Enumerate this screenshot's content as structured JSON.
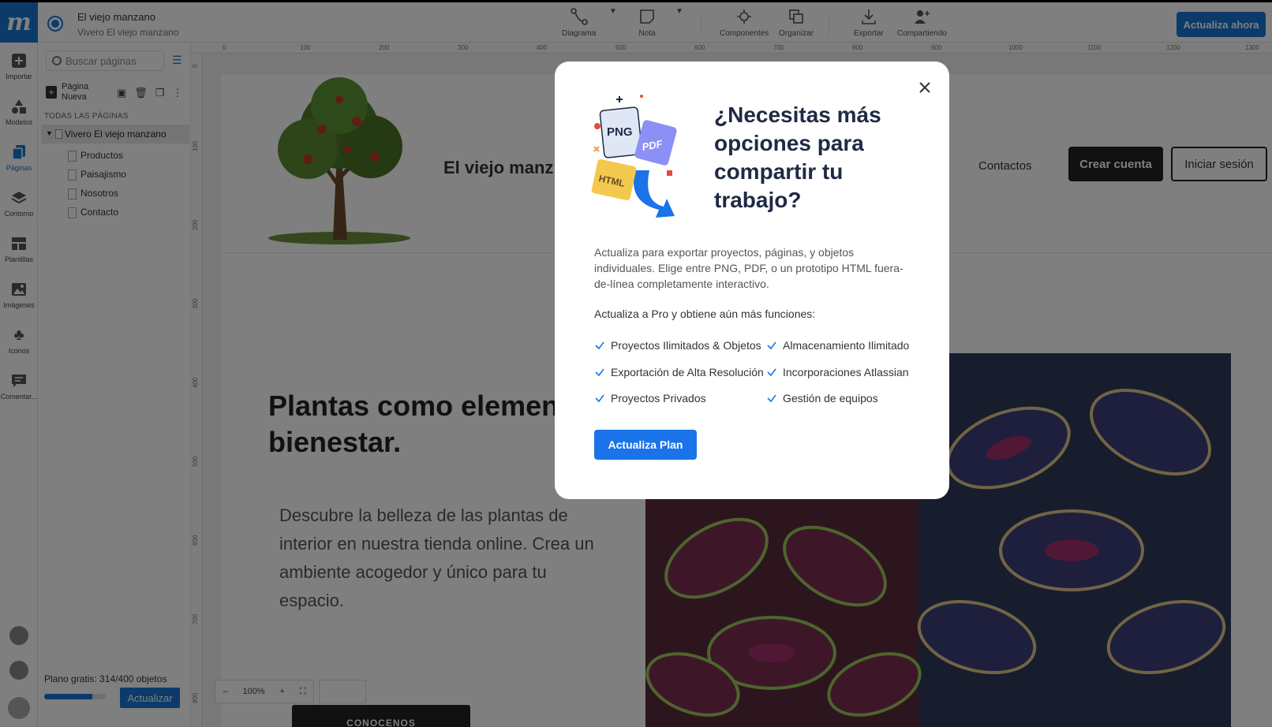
{
  "app": {
    "logo": "m",
    "project_title": "El viejo manzano",
    "project_subtitle": "Vivero El viejo manzano",
    "upgrade_now": "Actualiza ahora"
  },
  "toolbar": [
    {
      "label": "Diagrama",
      "icon": "diagram-icon"
    },
    {
      "label": "Nota",
      "icon": "note-icon"
    },
    {
      "label": "Componentes",
      "icon": "components-icon"
    },
    {
      "label": "Organizar",
      "icon": "arrange-icon"
    },
    {
      "label": "Exportar",
      "icon": "export-icon"
    },
    {
      "label": "Compartiendo",
      "icon": "share-icon"
    }
  ],
  "rail": [
    {
      "label": "Importar",
      "icon": "plus-icon"
    },
    {
      "label": "Modelos",
      "icon": "shapes-icon"
    },
    {
      "label": "Páginas",
      "icon": "pages-icon"
    },
    {
      "label": "Contorno",
      "icon": "layers-icon"
    },
    {
      "label": "Plantillas",
      "icon": "templates-icon"
    },
    {
      "label": "Imágenes",
      "icon": "image-icon"
    },
    {
      "label": "Iconos",
      "icon": "club-icon"
    },
    {
      "label": "Comentar...",
      "icon": "comment-icon"
    }
  ],
  "pages_panel": {
    "search_placeholder": "Buscar páginas",
    "new_page": "Página Nueva",
    "all_pages": "TODAS LAS PÁGINAS",
    "root": "Vivero El viejo manzano",
    "children": [
      "Productos",
      "Paisajismo",
      "Nosotros",
      "Contacto"
    ],
    "plan_text": "Plano gratis: 314/400 objetos",
    "plan_progress": 0.785,
    "plan_update": "Actualizar"
  },
  "ruler": {
    "top": [
      "0",
      "100",
      "200",
      "300",
      "400",
      "500",
      "600",
      "700",
      "800",
      "900",
      "1000",
      "1100",
      "1200",
      "1300"
    ],
    "left": [
      "0",
      "100",
      "200",
      "300",
      "400",
      "500",
      "600",
      "700",
      "800"
    ]
  },
  "site": {
    "brand": "El viejo manz",
    "nav_partial": "s",
    "nav_contact": "Contactos",
    "create_account": "Crear cuenta",
    "login": "Iniciar sesión",
    "hero_title": "Plantas como element bienestar.",
    "hero_text": "Descubre la belleza de las plantas de interior en nuestra tienda online. Crea un ambiente acogedor y único para tu espacio.",
    "hero_cta": "CONOCENOS"
  },
  "zoom": {
    "minus": "–",
    "level": "100%",
    "plus": "+"
  },
  "modal": {
    "title": "¿Necesitas más opciones para compartir tu trabajo?",
    "description": "Actualiza para exportar proyectos, páginas, y objetos individuales. Elige entre PNG, PDF, o un prototipo HTML fuera-de-línea completamente interactivo.",
    "subtitle": "Actualiza a Pro y obtiene aún más funciones:",
    "features": [
      "Proyectos Ilimitados & Objetos",
      "Almacenamiento Ilimitado",
      "Exportación de Alta Resolución",
      "Incorporaciones Atlassian",
      "Proyectos Privados",
      "Gestión de equipos"
    ],
    "cta": "Actualiza Plan",
    "illustration_labels": {
      "png": "PNG",
      "pdf": "PDF",
      "html": "HTML"
    }
  },
  "colors": {
    "accent": "#1a73e8",
    "title": "#1f2a44",
    "overlay": "rgba(0,0,0,0.5)"
  }
}
